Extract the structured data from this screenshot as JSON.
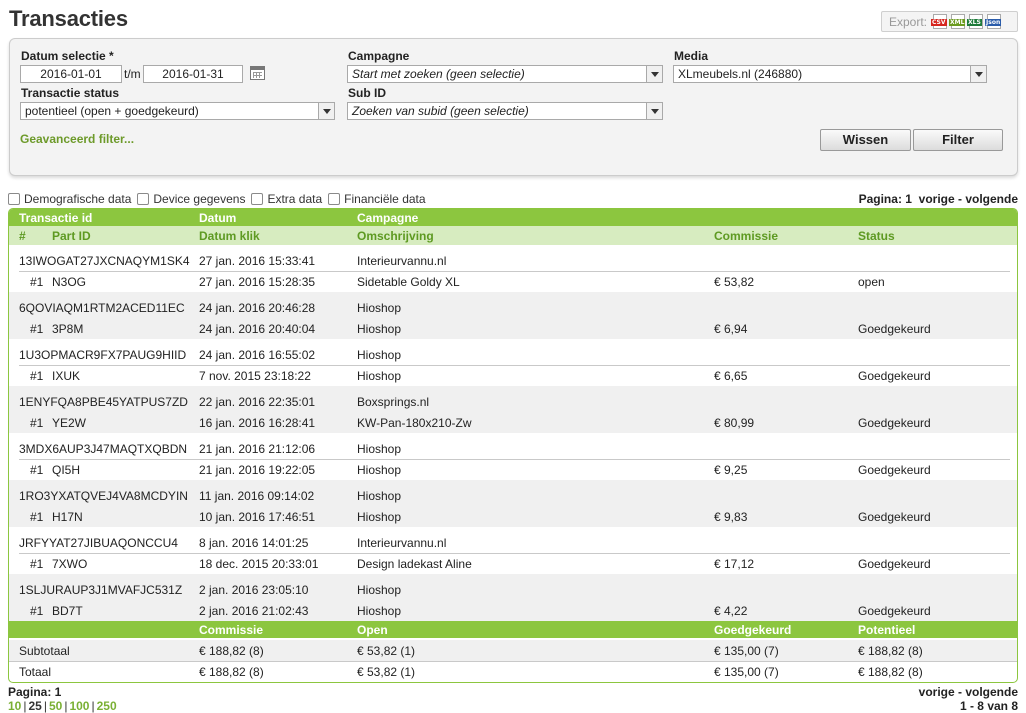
{
  "title": "Transacties",
  "export": {
    "label": "Export:",
    "formats": [
      "CSV",
      "XML",
      "XLS",
      "Json"
    ]
  },
  "filters": {
    "date_label": "Datum selectie *",
    "date_from": "2016-01-01",
    "date_sep": "t/m",
    "date_to": "2016-01-31",
    "campaign_label": "Campagne",
    "campaign_value": "Start met zoeken (geen selectie)",
    "media_label": "Media",
    "media_value": "XLmeubels.nl (246880)",
    "status_label": "Transactie status",
    "status_value": "potentieel (open + goedgekeurd)",
    "subid_label": "Sub ID",
    "subid_value": "Zoeken van subid (geen selectie)",
    "advanced_link": "Geavanceerd filter...",
    "clear_button": "Wissen",
    "filter_button": "Filter"
  },
  "options": [
    "Demografische data",
    "Device gegevens",
    "Extra data",
    "Financiële data"
  ],
  "pager_top": {
    "label": "Pagina:",
    "page": "1",
    "nav": "vorige - volgende"
  },
  "table": {
    "header1": [
      "Transactie id",
      "Datum",
      "Campagne"
    ],
    "header2": [
      "#",
      "Part ID",
      "Datum klik",
      "Omschrijving",
      "Commissie",
      "Status"
    ],
    "transactions": [
      {
        "id": "13IWOGAT27JXCNAQYM1SK4",
        "date": "27 jan. 2016 15:33:41",
        "campaign": "Interieurvannu.nl",
        "num": "#1",
        "part_id": "N3OG",
        "click_date": "27 jan. 2016 15:28:35",
        "description": "Sidetable Goldy XL",
        "commission": "€ 53,82",
        "status": "open"
      },
      {
        "id": "6QOVIAQM1RTM2ACED11EC",
        "date": "24 jan. 2016 20:46:28",
        "campaign": "Hioshop",
        "num": "#1",
        "part_id": "3P8M",
        "click_date": "24 jan. 2016 20:40:04",
        "description": "Hioshop",
        "commission": "€ 6,94",
        "status": "Goedgekeurd"
      },
      {
        "id": "1U3OPMACR9FX7PAUG9HIID",
        "date": "24 jan. 2016 16:55:02",
        "campaign": "Hioshop",
        "num": "#1",
        "part_id": "IXUK",
        "click_date": "7 nov. 2015 23:18:22",
        "description": "Hioshop",
        "commission": "€ 6,65",
        "status": "Goedgekeurd"
      },
      {
        "id": "1ENYFQA8PBE45YATPUS7ZD",
        "date": "22 jan. 2016 22:35:01",
        "campaign": "Boxsprings.nl",
        "num": "#1",
        "part_id": "YE2W",
        "click_date": "16 jan. 2016 16:28:41",
        "description": "KW-Pan-180x210-Zw",
        "commission": "€ 80,99",
        "status": "Goedgekeurd"
      },
      {
        "id": "3MDX6AUP3J47MAQTXQBDN",
        "date": "21 jan. 2016 21:12:06",
        "campaign": "Hioshop",
        "num": "#1",
        "part_id": "QI5H",
        "click_date": "21 jan. 2016 19:22:05",
        "description": "Hioshop",
        "commission": "€ 9,25",
        "status": "Goedgekeurd"
      },
      {
        "id": "1RO3YXATQVEJ4VA8MCDYIN",
        "date": "11 jan. 2016 09:14:02",
        "campaign": "Hioshop",
        "num": "#1",
        "part_id": "H17N",
        "click_date": "10 jan. 2016 17:46:51",
        "description": "Hioshop",
        "commission": "€ 9,83",
        "status": "Goedgekeurd"
      },
      {
        "id": "JRFYYAT27JIBUAQONCCU4",
        "date": "8 jan. 2016 14:01:25",
        "campaign": "Interieurvannu.nl",
        "num": "#1",
        "part_id": "7XWO",
        "click_date": "18 dec. 2015 20:33:01",
        "description": "Design ladekast Aline",
        "commission": "€ 17,12",
        "status": "Goedgekeurd"
      },
      {
        "id": "1SLJURAUP3J1MVAFJC531Z",
        "date": "2 jan. 2016 23:05:10",
        "campaign": "Hioshop",
        "num": "#1",
        "part_id": "BD7T",
        "click_date": "2 jan. 2016 21:02:43",
        "description": "Hioshop",
        "commission": "€ 4,22",
        "status": "Goedgekeurd"
      }
    ],
    "footer_header": [
      "Commissie",
      "Open",
      "Goedgekeurd",
      "Potentieel"
    ],
    "subtotal": {
      "label": "Subtotaal",
      "commission": "€ 188,82 (8)",
      "open": "€ 53,82 (1)",
      "approved": "€ 135,00 (7)",
      "potential": "€ 188,82 (8)"
    },
    "total": {
      "label": "Totaal",
      "commission": "€ 188,82 (8)",
      "open": "€ 53,82 (1)",
      "approved": "€ 135,00 (7)",
      "potential": "€ 188,82 (8)"
    }
  },
  "pager_bottom": {
    "label": "Pagina: 1",
    "nav": "vorige - volgende",
    "page_sizes": [
      "10",
      "25",
      "50",
      "100",
      "250"
    ],
    "active_size": "25",
    "range": "1 - 8 van 8"
  }
}
